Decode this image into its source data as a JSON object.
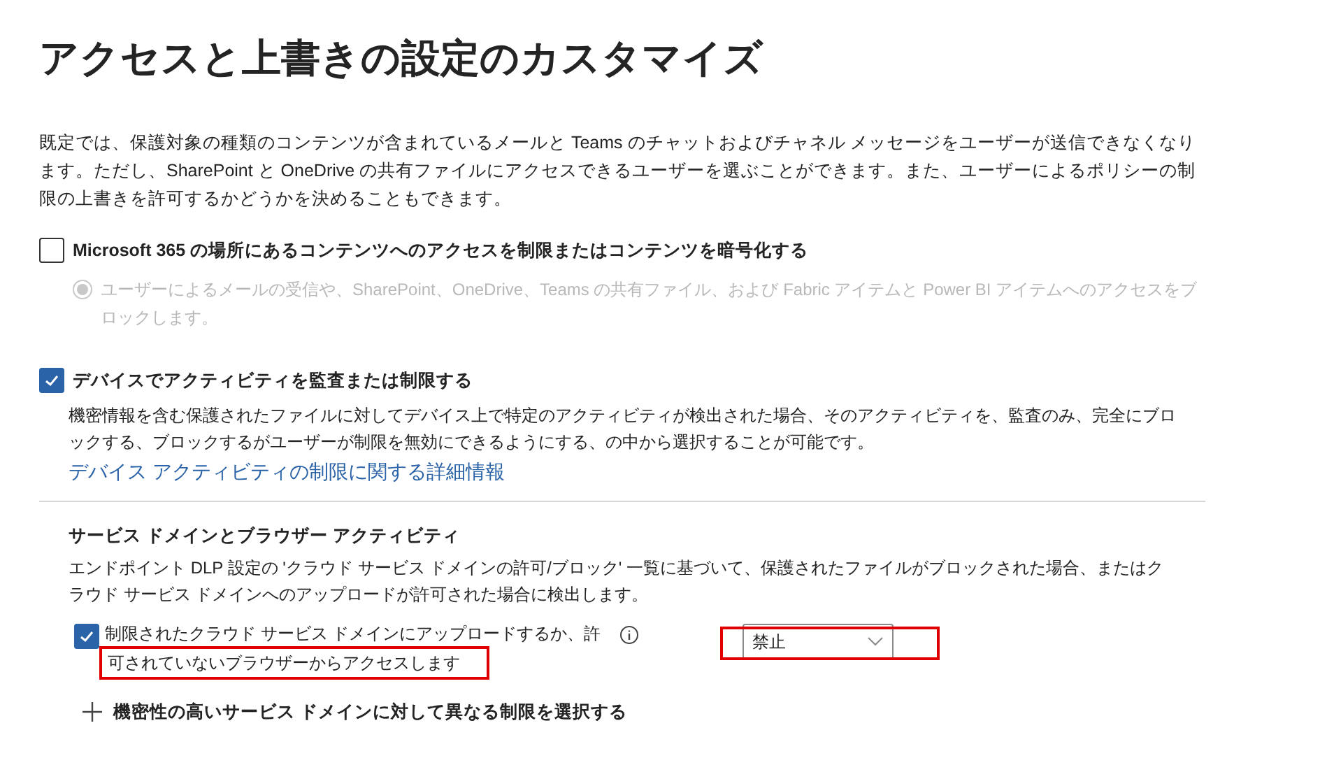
{
  "title": "アクセスと上書きの設定のカスタマイズ",
  "intro": "既定では、保護対象の種類のコンテンツが含まれているメールと Teams のチャットおよびチャネル メッセージをユーザーが送信できなくなります。ただし、SharePoint と OneDrive の共有ファイルにアクセスできるユーザーを選ぶことができます。また、ユーザーによるポリシーの制限の上書きを許可するかどうかを決めることもできます。",
  "restrict_access": {
    "label": "Microsoft 365 の場所にあるコンテンツへのアクセスを制限またはコンテンツを暗号化する",
    "checked": false,
    "option": {
      "label": "ユーザーによるメールの受信や、SharePoint、OneDrive、Teams の共有ファイル、および Fabric アイテムと Power BI アイテムへのアクセスをブロックします。",
      "selected": true,
      "disabled": true
    }
  },
  "device_activity": {
    "label": "デバイスでアクティビティを監査または制限する",
    "checked": true,
    "description": "機密情報を含む保護されたファイルに対してデバイス上で特定のアクティビティが検出された場合、そのアクティビティを、監査のみ、完全にブロックする、ブロックするがユーザーが制限を無効にできるようにする、の中から選択することが可能です。",
    "link": "デバイス アクティビティの制限に関する詳細情報"
  },
  "service_domain": {
    "heading": "サービス ドメインとブラウザー アクティビティ",
    "description": "エンドポイント DLP 設定の 'クラウド サービス ドメインの許可/ブロック' 一覧に基づいて、保護されたファイルがブロックされた場合、またはクラウド サービス ドメインへのアップロードが許可された場合に検出します。",
    "rule": {
      "label_line1": "制限されたクラウド サービス ドメインにアップロードするか、許",
      "label_line2": "可されていないブラウザーからアクセスします",
      "checked": true,
      "action": "禁止"
    },
    "add_link": "機密性の高いサービス ドメインに対して異なる制限を選択する"
  }
}
